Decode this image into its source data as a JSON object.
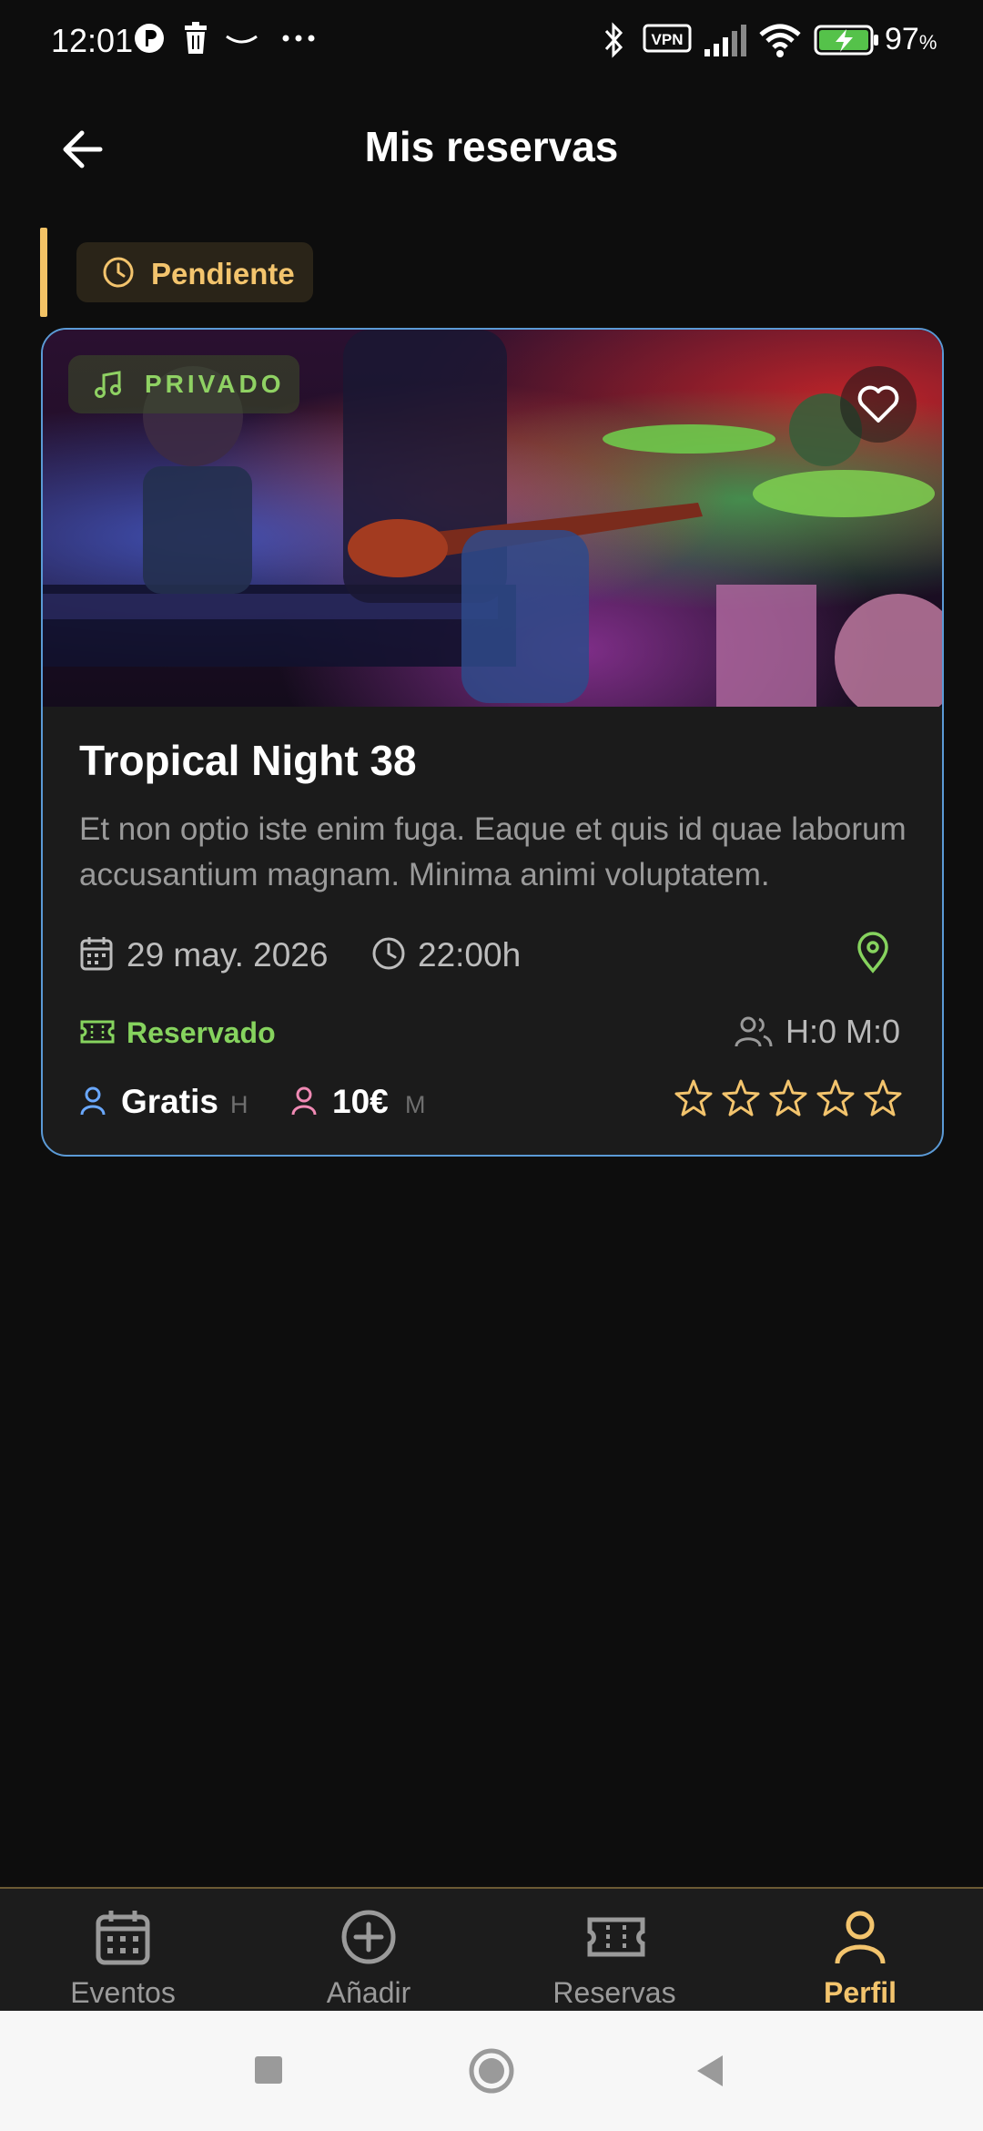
{
  "status_bar": {
    "time": "12:01",
    "battery_percent": "97",
    "battery_unit": "%"
  },
  "header": {
    "title": "Mis reservas"
  },
  "section": {
    "status_label": "Pendiente",
    "accent_color": "#f2c265"
  },
  "event": {
    "tag": "PRIVADO",
    "title": "Tropical Night 38",
    "description": "Et non optio iste enim fuga. Eaque et quis id quae laborum accusantium magnam. Minima animi voluptatem.",
    "date": "29 may. 2026",
    "time": "22:00h",
    "booking_status": "Reservado",
    "attendees": "H:0 M:0",
    "price_male": "Gratis",
    "price_male_suffix": "H",
    "price_female": "10€",
    "price_female_suffix": "M",
    "rating": 0,
    "rating_max": 5
  },
  "bottom_nav": {
    "items": [
      {
        "label": "Eventos",
        "icon": "calendar-icon"
      },
      {
        "label": "Añadir",
        "icon": "plus-circle-icon"
      },
      {
        "label": "Reservas",
        "icon": "ticket-icon"
      },
      {
        "label": "Perfil",
        "icon": "user-icon",
        "active": true
      }
    ],
    "active_color": "#f3c46d"
  }
}
